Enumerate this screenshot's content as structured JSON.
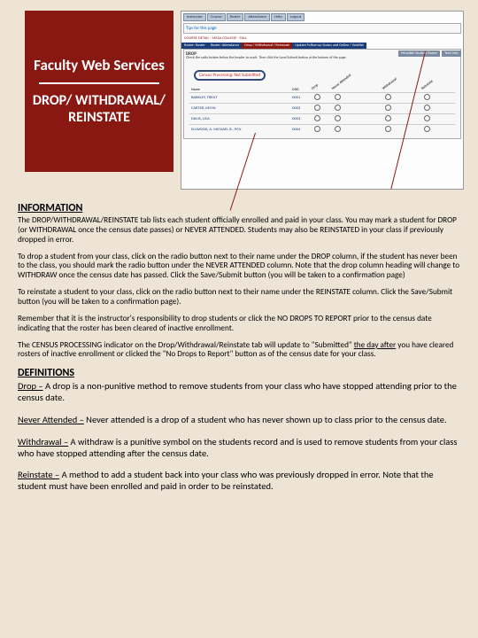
{
  "banner": {
    "title": "Faculty Web Services",
    "subtitle": "DROP/ WITHDRAWAL/ REINSTATE"
  },
  "screenshot": {
    "tabs": [
      "Instructor",
      "Course",
      "Roster",
      "Attendance",
      "Help",
      "Logout"
    ],
    "tips": "Tips for this page",
    "crumb": "COURSE DETAIL · MESA COLLEGE · FALL",
    "filter_btns": [
      "Printable Student Roster",
      "Text Only"
    ],
    "subtabs": [
      "Roster: Roster",
      "Roster: Attendance",
      "Drop / Withdrawal / Reinstate",
      "Update Follow-up Status and Online / Waitlist"
    ],
    "drop_heading": "DROP",
    "drop_note": "Check the radio button below the header to mark. Then click the Save/Submit button at the bottom of the page.",
    "badge": "Census Processing: Not Submitted",
    "cols": [
      "Name",
      "CSID",
      "Drop",
      "Never Attended",
      "Withdrawal",
      "Reinstate"
    ],
    "rows": [
      {
        "name": "BARKLEY, TRENT",
        "id": "0001",
        "marks": [
          "○",
          "○",
          "○",
          "○"
        ]
      },
      {
        "name": "CARTER, KEVIN",
        "id": "0002",
        "marks": [
          "○",
          "○",
          "○",
          "○"
        ]
      },
      {
        "name": "DAVIS, LISA",
        "id": "0003",
        "marks": [
          "○",
          "○",
          "○",
          "○"
        ]
      },
      {
        "name": "ELLWOOD, A. MICHAEL B., PCN",
        "id": "0004",
        "marks": [
          "○",
          "○",
          "○",
          "○"
        ]
      }
    ]
  },
  "info": {
    "heading": "INFORMATION",
    "p1": "The DROP/WITHDRAWAL/REINSTATE tab lists each student officially enrolled and paid in your class. You may mark a student for DROP (or WITHDRAWAL once the census date passes) or NEVER ATTENDED. Students may also be REINSTATED in your class if previously dropped in error.",
    "p2": "To drop a student from your class, click on the radio button next to their name under the DROP column, if the student has never been to the class, you should mark the radio button under the NEVER ATTENDED column. Note that the drop column heading will change to WITHDRAW once the census date has passed. Click the Save/Submit button (you will be taken to a confirmation page)",
    "p3": "To reinstate a student to your class, click on the radio button next to their name under the REINSTATE column. Click the Save/Submit button (you will be taken to a confirmation page).",
    "p4": "Remember that it is the instructor's responsibility to drop students or click the NO DROPS TO REPORT prior to the census date indicating that the roster has been cleared of inactive enrollment.",
    "p5a": "The CENSUS PROCESSING indicator on the Drop/Withdrawal/Reinstate tab will update to \"Submitted\" ",
    "p5u": "the day after",
    "p5b": " you have cleared rosters of inactive enrollment or clicked the \"No Drops to Report\" button as of the census date for your class."
  },
  "defs": {
    "heading": "DEFINITIONS",
    "d1l": "Drop –",
    "d1t": " A drop is a non-punitive method to remove students from your class who have stopped attending prior to the census date.",
    "d2l": "Never Attended –",
    "d2t": " Never attended is a drop of a student who has never shown up to class prior to the census date.",
    "d3l": "Withdrawal –",
    "d3t": " A withdraw is a punitive symbol on the students record and is used to remove students from your class who have stopped attending after the census date.",
    "d4l": "Reinstate –",
    "d4t": " A method to add a student back into your class who was previously dropped in error. Note that the student must have been enrolled and paid in order to be reinstated."
  }
}
